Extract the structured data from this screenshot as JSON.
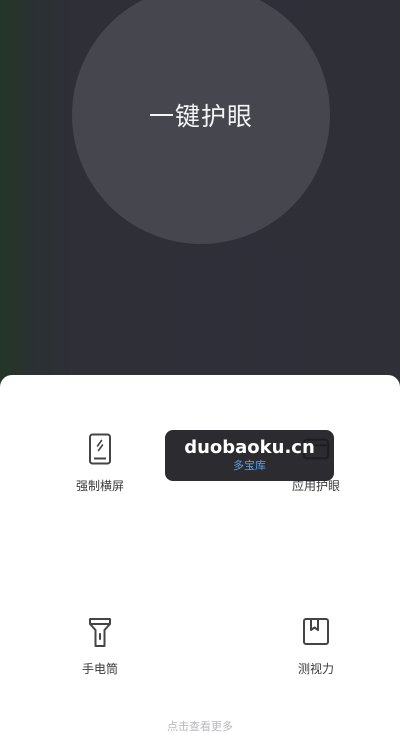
{
  "main": {
    "eye_protect_button_label": "一键护眼"
  },
  "tools": {
    "rotate": {
      "label": "强制横屏",
      "icon": "phone-rotate-icon"
    },
    "app_protect": {
      "label": "应用护眼",
      "icon": "app-window-icon"
    },
    "flashlight": {
      "label": "手电筒",
      "icon": "flashlight-icon"
    },
    "vision_test": {
      "label": "测视力",
      "icon": "book-bookmark-icon"
    }
  },
  "watermark": {
    "site": "duobaoku.cn",
    "name": "多宝库"
  },
  "footer": {
    "more_hint": "点击查看更多"
  },
  "colors": {
    "background_dark": "#2e2f36",
    "circle": "#45464e",
    "sheet": "#ffffff",
    "icon_stroke": "#444444"
  }
}
